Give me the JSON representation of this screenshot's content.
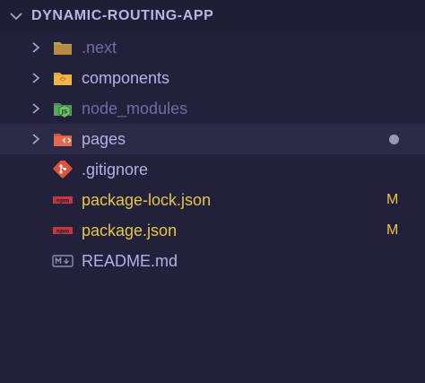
{
  "explorer": {
    "root_label": "DYNAMIC-ROUTING-APP",
    "items": [
      {
        "name": ".next",
        "kind": "folder",
        "icon": "folder-icon",
        "state": "dim"
      },
      {
        "name": "components",
        "kind": "folder",
        "icon": "components-folder-icon",
        "state": "normal"
      },
      {
        "name": "node_modules",
        "kind": "folder",
        "icon": "node-folder-icon",
        "state": "dim"
      },
      {
        "name": "pages",
        "kind": "folder",
        "icon": "pages-folder-icon",
        "state": "normal",
        "selected": true,
        "indicator": "dot"
      },
      {
        "name": ".gitignore",
        "kind": "file",
        "icon": "git-icon",
        "state": "normal"
      },
      {
        "name": "package-lock.json",
        "kind": "file",
        "icon": "npm-icon",
        "state": "modified",
        "badge": "M"
      },
      {
        "name": "package.json",
        "kind": "file",
        "icon": "npm-icon",
        "state": "modified",
        "badge": "M"
      },
      {
        "name": "README.md",
        "kind": "file",
        "icon": "markdown-icon",
        "state": "normal"
      }
    ]
  },
  "colors": {
    "background": "#22213b",
    "header_background": "#1f1e35",
    "selected_background": "#2b2a47",
    "modified_text": "#e8c546",
    "normal_text": "#b3b1e3",
    "dim_text": "#6f6da3"
  }
}
